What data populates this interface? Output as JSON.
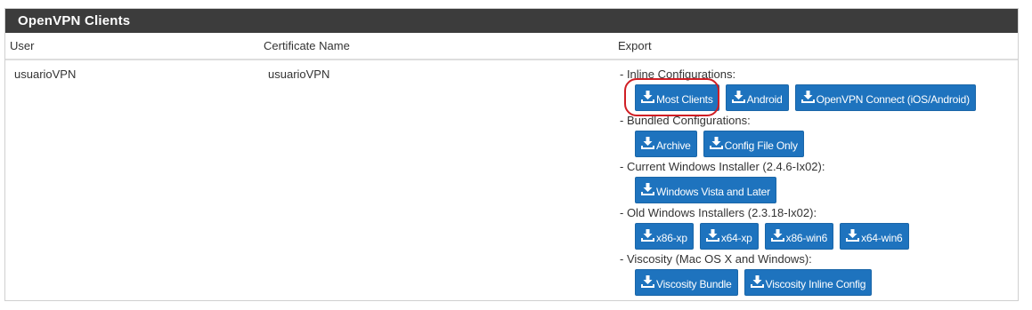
{
  "panel": {
    "title": "OpenVPN Clients",
    "columns": {
      "user": "User",
      "cert": "Certificate Name",
      "export": "Export"
    }
  },
  "row": {
    "user": "usuarioVPN",
    "cert": "usuarioVPN"
  },
  "groups": {
    "inline": {
      "label": "- Inline Configurations:",
      "buttons": {
        "most_clients": "Most Clients",
        "android": "Android",
        "openvpn_connect": "OpenVPN Connect (iOS/Android)"
      }
    },
    "bundled": {
      "label": "- Bundled Configurations:",
      "buttons": {
        "archive": "Archive",
        "config_only": "Config File Only"
      }
    },
    "current_win": {
      "label": "- Current Windows Installer (2.4.6-Ix02):",
      "buttons": {
        "vista": "Windows Vista and Later"
      }
    },
    "old_win": {
      "label": "- Old Windows Installers (2.3.18-Ix02):",
      "buttons": {
        "x86xp": "x86-xp",
        "x64xp": "x64-xp",
        "x86win6": "x86-win6",
        "x64win6": "x64-win6"
      }
    },
    "viscosity": {
      "label": "- Viscosity (Mac OS X and Windows):",
      "buttons": {
        "bundle": "Viscosity Bundle",
        "inline": "Viscosity Inline Config"
      }
    }
  },
  "icons": {
    "button_icon": "download-icon"
  },
  "colors": {
    "heading_bg": "#3c3c3c",
    "button_bg": "#1e73be",
    "highlight": "#d01e24"
  }
}
